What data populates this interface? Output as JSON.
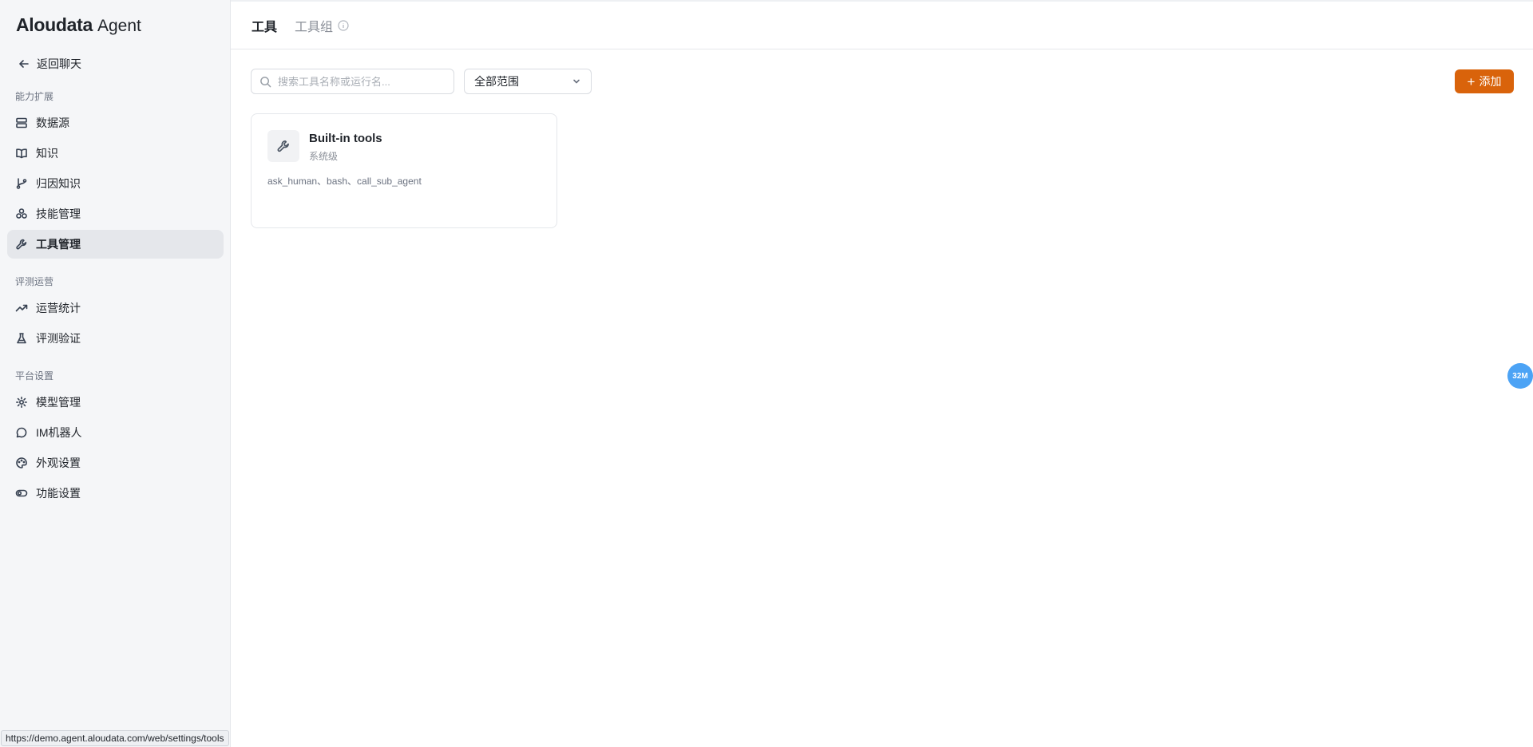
{
  "sidebar": {
    "logo_brand": "Aloudata",
    "logo_product": "Agent",
    "back_label": "返回聊天",
    "sections": [
      {
        "label": "能力扩展"
      },
      {
        "label": "评测运营"
      },
      {
        "label": "平台设置"
      }
    ],
    "items": [
      {
        "label": "数据源",
        "icon": "database-icon"
      },
      {
        "label": "知识",
        "icon": "book-icon"
      },
      {
        "label": "归因知识",
        "icon": "branch-icon"
      },
      {
        "label": "技能管理",
        "icon": "skills-icon"
      },
      {
        "label": "工具管理",
        "icon": "wrench-icon",
        "active": true
      },
      {
        "label": "运营统计",
        "icon": "trending-up-icon"
      },
      {
        "label": "评测验证",
        "icon": "flask-icon"
      },
      {
        "label": "模型管理",
        "icon": "gear-icon"
      },
      {
        "label": "IM机器人",
        "icon": "chat-bubble-icon"
      },
      {
        "label": "外观设置",
        "icon": "palette-icon"
      },
      {
        "label": "功能设置",
        "icon": "toggle-icon"
      }
    ]
  },
  "tabs": [
    {
      "label": "工具",
      "active": true
    },
    {
      "label": "工具组",
      "active": false
    }
  ],
  "toolbar": {
    "search_placeholder": "搜索工具名称或运行名...",
    "search_value": "",
    "scope_selected": "全部范围",
    "add_label": "添加"
  },
  "cards": [
    {
      "title": "Built-in tools",
      "subtitle": "系统级",
      "tools": "ask_human、bash、call_sub_agent",
      "icon": "wrench-icon"
    }
  ],
  "float_badge": "32M",
  "status_url": "https://demo.agent.aloudata.com/web/settings/tools",
  "colors": {
    "accent": "#d9630b",
    "sidebar_bg": "#f5f6f8",
    "active_item_bg": "#e5e7eb",
    "badge": "#4ca3f5"
  }
}
